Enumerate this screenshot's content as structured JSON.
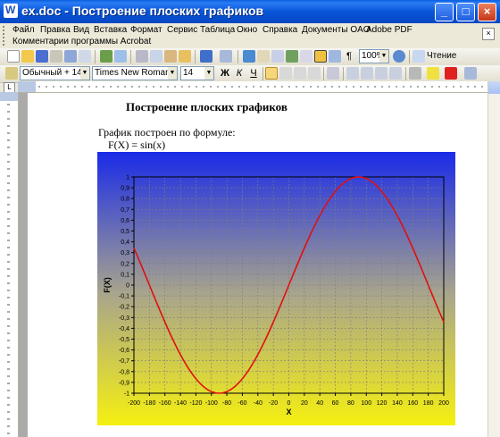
{
  "window": {
    "title": "ex.doc - Построение плоских графиков",
    "controls": {
      "minimize": "_",
      "maximize": "□",
      "close": "×"
    }
  },
  "menu": {
    "items": [
      "Файл",
      "Правка",
      "Вид",
      "Вставка",
      "Формат",
      "Сервис",
      "Таблица",
      "Окно",
      "Справка",
      "Документы OAO",
      "Adobe PDF"
    ],
    "second_row": "Комментарии программы Acrobat"
  },
  "toolbar_standard": {
    "zoom": "100%",
    "reading_button": "Чтение"
  },
  "toolbar_format": {
    "style": "Обычный + 14 m",
    "font": "Times New Roman",
    "size": "14",
    "bold": "Ж",
    "italic": "К",
    "underline": "Ч"
  },
  "document": {
    "heading": "Построение плоских графиков",
    "caption": "График построен по формуле:",
    "formula": "F(X) = sin(x)"
  },
  "chart_data": {
    "type": "line",
    "xlabel": "X",
    "ylabel": "F(X)",
    "xlim": [
      -200,
      200
    ],
    "ylim": [
      -1,
      1
    ],
    "x_ticks": [
      -200,
      -180,
      -160,
      -140,
      -120,
      -100,
      -80,
      -60,
      -40,
      -20,
      0,
      20,
      40,
      60,
      80,
      100,
      120,
      140,
      160,
      180,
      200
    ],
    "y_ticks": [
      -1,
      -0.9,
      -0.8,
      -0.7,
      -0.6,
      -0.5,
      -0.4,
      -0.3,
      -0.2,
      -0.1,
      0,
      0.1,
      0.2,
      0.3,
      0.4,
      0.5,
      0.6,
      0.7,
      0.8,
      0.9,
      1
    ],
    "y_tick_labels": [
      "-1",
      "-0,9",
      "-0,8",
      "-0,7",
      "-0,6",
      "-0,5",
      "-0,4",
      "-0,3",
      "-0,2",
      "-0,1",
      "0",
      "0,1",
      "0,2",
      "0,3",
      "0,4",
      "0,5",
      "0,6",
      "0,7",
      "0,8",
      "0,9",
      "1"
    ],
    "grid": true,
    "series": [
      {
        "color": "#E01010",
        "x": [
          -200,
          -190,
          -180,
          -170,
          -160,
          -150,
          -140,
          -130,
          -120,
          -110,
          -100,
          -90,
          -80,
          -70,
          -60,
          -50,
          -40,
          -30,
          -20,
          -10,
          0,
          10,
          20,
          30,
          40,
          50,
          60,
          70,
          80,
          90,
          100,
          110,
          120,
          130,
          140,
          150,
          160,
          170,
          180,
          190,
          200
        ],
        "values": [
          0.342,
          0.174,
          0,
          -0.174,
          -0.342,
          -0.5,
          -0.643,
          -0.766,
          -0.866,
          -0.94,
          -0.985,
          -1,
          -0.985,
          -0.94,
          -0.866,
          -0.766,
          -0.643,
          -0.5,
          -0.342,
          -0.174,
          0,
          0.174,
          0.342,
          0.5,
          0.643,
          0.766,
          0.866,
          0.94,
          0.985,
          1,
          0.985,
          0.94,
          0.866,
          0.766,
          0.643,
          0.5,
          0.342,
          0.174,
          0,
          -0.174,
          -0.342
        ]
      }
    ],
    "background": {
      "top": "#1A2BE8",
      "bottom": "#F5F010"
    }
  }
}
